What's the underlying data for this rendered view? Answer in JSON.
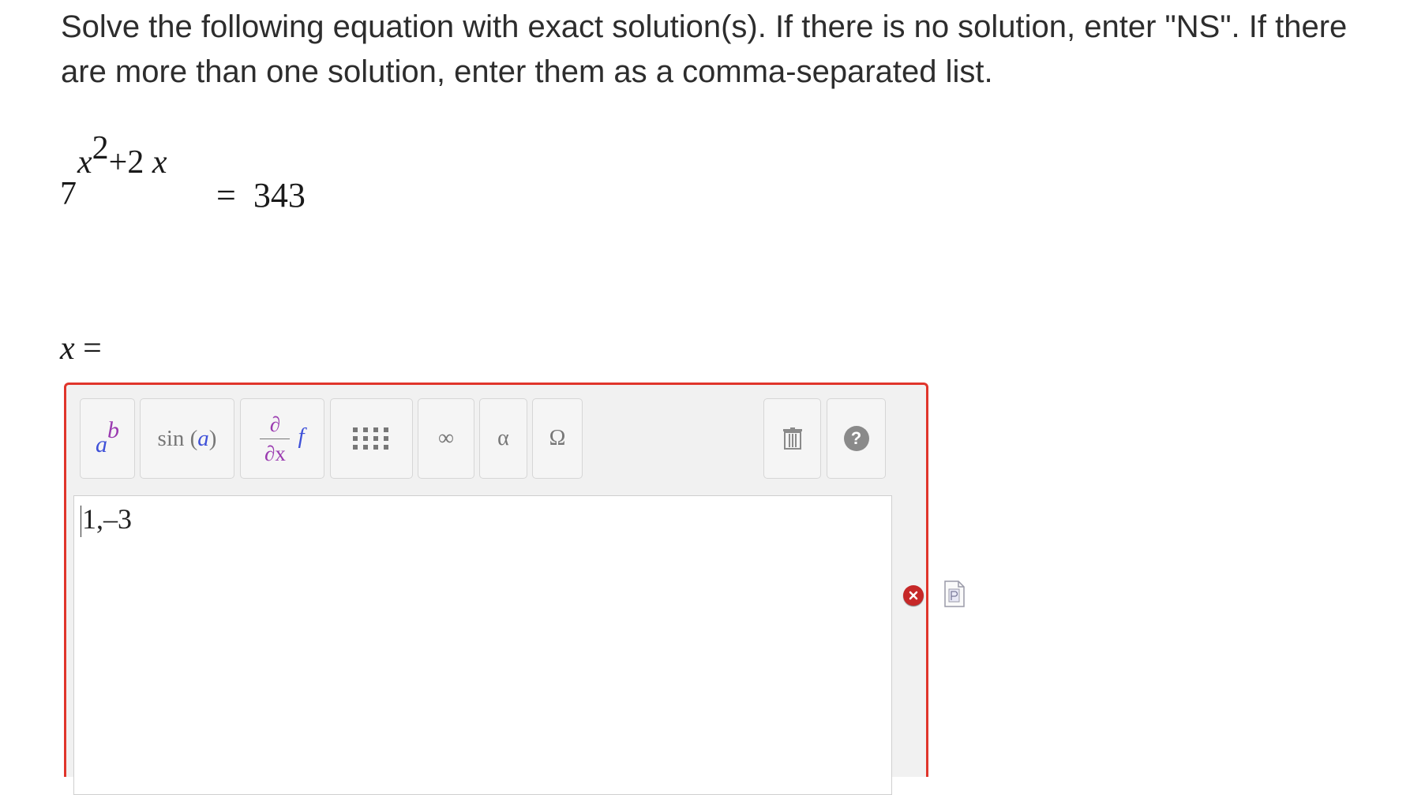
{
  "question": {
    "text": "Solve the following equation with exact solution(s). If there is no solution, enter \"NS\". If there are more than one solution, enter them as a comma-separated list."
  },
  "equation": {
    "base": "7",
    "exponent_var": "x",
    "exponent_power": "2",
    "exponent_rest_a": "+2",
    "exponent_rest_var": "x",
    "equals": "=",
    "rhs": "343"
  },
  "answer_label": {
    "variable": "x",
    "equals": "="
  },
  "toolbar": {
    "power_base": "a",
    "power_exp": "b",
    "sin_prefix": "sin (",
    "sin_arg": "a",
    "sin_suffix": ")",
    "deriv_top": "∂",
    "deriv_bottom": "∂x",
    "deriv_f": "f",
    "infinity": "∞",
    "alpha": "α",
    "omega": "Ω",
    "help": "?"
  },
  "answer_input": {
    "value": "1,–3"
  },
  "status": {
    "state": "incorrect",
    "error_color": "#c62828",
    "border_color": "#e0352b"
  }
}
